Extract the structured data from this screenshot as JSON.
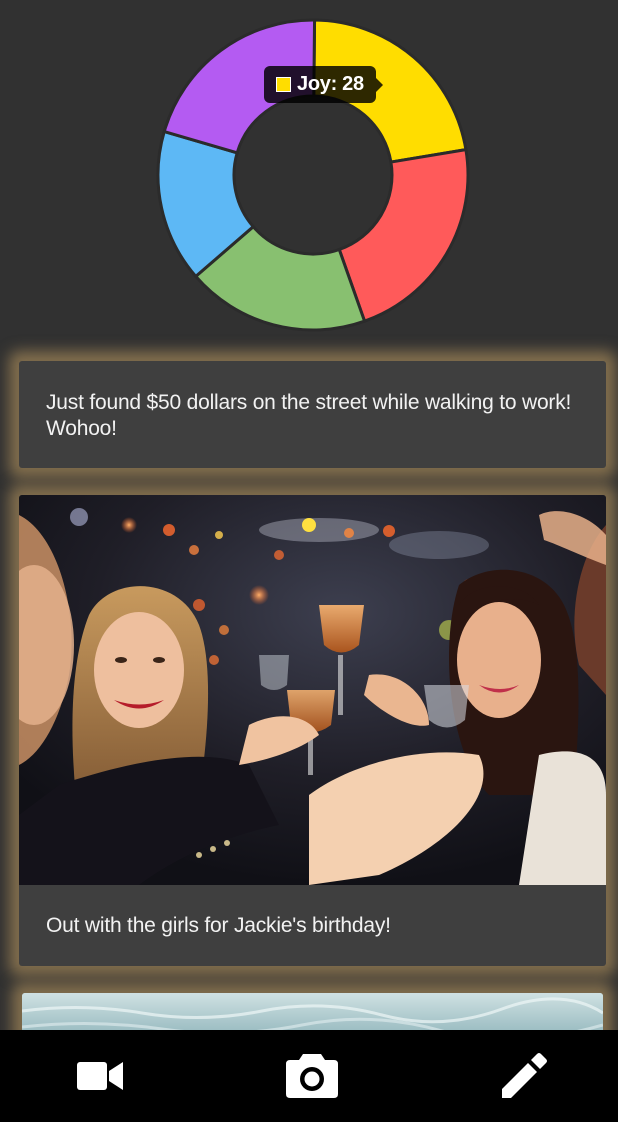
{
  "chart_data": {
    "type": "pie",
    "categories": [
      "Joy",
      "",
      "",
      "",
      ""
    ],
    "values": [
      28,
      28,
      24,
      20,
      26
    ],
    "colors": [
      "#FFDD00",
      "#FF5A5A",
      "#88C070",
      "#5DB8F5",
      "#B45BF2"
    ],
    "title": "",
    "donut": true
  },
  "tooltip": {
    "label": "Joy: 28",
    "color": "#FFDD00"
  },
  "feed": {
    "post1": {
      "text": "Just found $50 dollars on the street while walking to work! Wohoo!"
    },
    "post2": {
      "text": "Out with the girls for Jackie's birthday!"
    }
  },
  "bottom_bar": {
    "icons": [
      "video-camera-icon",
      "camera-icon",
      "pencil-icon"
    ]
  }
}
